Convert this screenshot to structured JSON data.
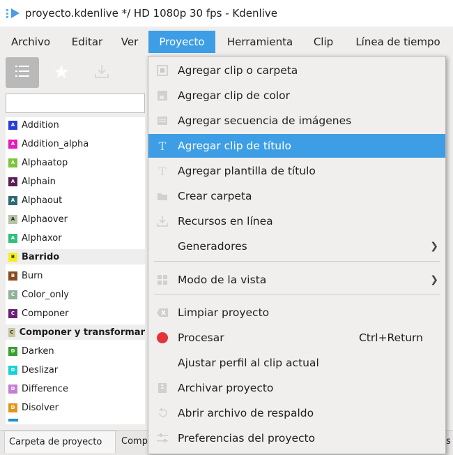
{
  "window": {
    "title": "proyecto.kdenlive */ HD 1080p 30 fps - Kdenlive"
  },
  "menubar": [
    "Archivo",
    "Editar",
    "Ver",
    "Proyecto",
    "Herramienta",
    "Clip",
    "Línea de tiempo"
  ],
  "toolbar": {
    "icons": [
      "list-icon",
      "star-icon",
      "download-icon"
    ]
  },
  "search": {
    "value": ""
  },
  "effects": [
    {
      "badge": "A",
      "color": "#2a3fd8",
      "label": "Addition",
      "bold": false
    },
    {
      "badge": "A",
      "color": "#e51ab8",
      "label": "Addition_alpha",
      "bold": false
    },
    {
      "badge": "A",
      "color": "#7cc43a",
      "label": "Alphaatop",
      "bold": false
    },
    {
      "badge": "A",
      "color": "#5b1e55",
      "label": "Alphain",
      "bold": false
    },
    {
      "badge": "A",
      "color": "#2d6a73",
      "label": "Alphaout",
      "bold": false
    },
    {
      "badge": "A",
      "color": "#b7c3a6",
      "label": "Alphaover",
      "bold": false
    },
    {
      "badge": "A",
      "color": "#2fc07b",
      "label": "Alphaxor",
      "bold": false
    },
    {
      "badge": "B",
      "color": "#f4f018",
      "label": "Barrido",
      "bold": true
    },
    {
      "badge": "B",
      "color": "#8a4b1d",
      "label": "Burn",
      "bold": false
    },
    {
      "badge": "C",
      "color": "#8fb19a",
      "label": "Color_only",
      "bold": false
    },
    {
      "badge": "C",
      "color": "#6a2076",
      "label": "Componer",
      "bold": false
    },
    {
      "badge": "C",
      "color": "#c9c79d",
      "label": "Componer y transformar",
      "bold": true
    },
    {
      "badge": "D",
      "color": "#3a9f2f",
      "label": "Darken",
      "bold": false
    },
    {
      "badge": "D",
      "color": "#18d1d6",
      "label": "Deslizar",
      "bold": false
    },
    {
      "badge": "D",
      "color": "#c77dd6",
      "label": "Difference",
      "bold": false
    },
    {
      "badge": "D",
      "color": "#e2951c",
      "label": "Disolver",
      "bold": false
    }
  ],
  "bottom_tabs": [
    "Carpeta de proyecto",
    "Comp"
  ],
  "menu": {
    "items": [
      {
        "label": "Agregar clip o carpeta",
        "icon": "add-clip-icon"
      },
      {
        "label": "Agregar clip de color",
        "icon": "color-clip-icon"
      },
      {
        "label": "Agregar secuencia de imágenes",
        "icon": "image-sequence-icon"
      },
      {
        "label": "Agregar clip de título",
        "icon": "title-clip-icon",
        "highlighted": true
      },
      {
        "label": "Agregar plantilla de título",
        "icon": "title-template-icon"
      },
      {
        "label": "Crear carpeta",
        "icon": "folder-icon"
      },
      {
        "label": "Recursos en línea",
        "icon": "online-resources-icon"
      },
      {
        "label": "Generadores",
        "icon": "",
        "submenu": true
      },
      {
        "label": "Modo de la vista",
        "icon": "view-mode-icon",
        "submenu": true
      },
      {
        "label": "Limpiar proyecto",
        "icon": "clean-icon"
      },
      {
        "label": "Procesar",
        "icon": "render-icon",
        "shortcut": "Ctrl+Return"
      },
      {
        "label": "Ajustar perfil al clip actual",
        "icon": ""
      },
      {
        "label": "Archivar proyecto",
        "icon": "archive-icon"
      },
      {
        "label": "Abrir archivo de respaldo",
        "icon": "backup-icon"
      },
      {
        "label": "Preferencias del proyecto",
        "icon": "settings-icon"
      }
    ]
  },
  "colors": {
    "accent": "#3d9ee5",
    "render_dot": "#e5323b"
  }
}
